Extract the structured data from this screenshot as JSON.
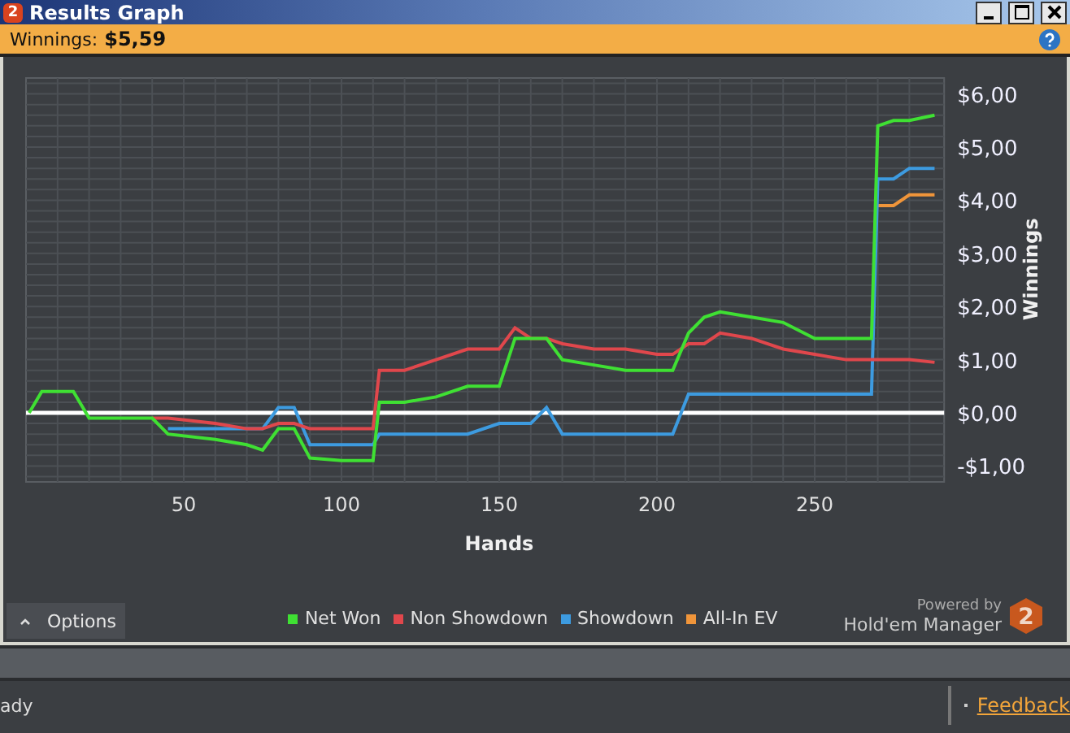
{
  "window": {
    "title": "Results Graph",
    "app_badge": "2"
  },
  "summary": {
    "label": "Winnings:",
    "value": "$5,59"
  },
  "chart": {
    "chart_data": {
      "type": "line",
      "grid": true,
      "xlabel": "Hands",
      "ylabel": "Winnings",
      "x": [
        1,
        5,
        15,
        20,
        40,
        45,
        60,
        70,
        75,
        80,
        85,
        90,
        100,
        110,
        112,
        120,
        130,
        140,
        150,
        155,
        160,
        165,
        170,
        180,
        190,
        200,
        205,
        210,
        215,
        220,
        230,
        240,
        250,
        260,
        268,
        270,
        275,
        280,
        288
      ],
      "xticks": [
        50,
        100,
        150,
        200,
        250
      ],
      "yticks": [
        {
          "value": -1,
          "label": "-$1,00"
        },
        {
          "value": 0,
          "label": "$0,00"
        },
        {
          "value": 1,
          "label": "$1,00"
        },
        {
          "value": 2,
          "label": "$2,00"
        },
        {
          "value": 3,
          "label": "$3,00"
        },
        {
          "value": 4,
          "label": "$4,00"
        },
        {
          "value": 5,
          "label": "$5,00"
        },
        {
          "value": 6,
          "label": "$6,00"
        }
      ],
      "ylim": [
        -1.3,
        6.3
      ],
      "xlim": [
        0,
        290
      ],
      "series": [
        {
          "name": "Net Won",
          "color": "#3fe033",
          "values": [
            0,
            0.4,
            0.4,
            -0.1,
            -0.1,
            -0.4,
            -0.5,
            -0.6,
            -0.7,
            -0.3,
            -0.3,
            -0.85,
            -0.9,
            -0.9,
            0.2,
            0.2,
            0.3,
            0.5,
            0.5,
            1.4,
            1.4,
            1.4,
            1.0,
            0.9,
            0.8,
            0.8,
            0.8,
            1.5,
            1.8,
            1.9,
            1.8,
            1.7,
            1.4,
            1.4,
            1.4,
            5.4,
            5.5,
            5.5,
            5.6
          ]
        },
        {
          "name": "Non Showdown",
          "color": "#e0474c",
          "values": [
            null,
            null,
            null,
            null,
            -0.1,
            -0.1,
            -0.2,
            -0.3,
            -0.3,
            -0.2,
            -0.2,
            -0.3,
            -0.3,
            -0.3,
            0.8,
            0.8,
            1.0,
            1.2,
            1.2,
            1.6,
            1.4,
            1.4,
            1.3,
            1.2,
            1.2,
            1.1,
            1.1,
            1.3,
            1.3,
            1.5,
            1.4,
            1.2,
            1.1,
            1.0,
            1.0,
            1.0,
            1.0,
            1.0,
            0.95
          ]
        },
        {
          "name": "Showdown",
          "color": "#3d9be0",
          "values": [
            null,
            null,
            null,
            null,
            null,
            -0.3,
            -0.3,
            -0.3,
            -0.3,
            0.1,
            0.1,
            -0.6,
            -0.6,
            -0.6,
            -0.4,
            -0.4,
            -0.4,
            -0.4,
            -0.2,
            -0.2,
            -0.2,
            0.1,
            -0.4,
            -0.4,
            -0.4,
            -0.4,
            -0.4,
            0.35,
            0.35,
            0.35,
            0.35,
            0.35,
            0.35,
            0.35,
            0.35,
            4.4,
            4.4,
            4.6,
            4.6
          ]
        },
        {
          "name": "All-In EV",
          "color": "#f0953a",
          "values": [
            null,
            null,
            null,
            null,
            null,
            null,
            null,
            null,
            null,
            null,
            null,
            null,
            null,
            null,
            null,
            null,
            null,
            null,
            null,
            null,
            null,
            null,
            null,
            null,
            null,
            null,
            null,
            null,
            null,
            null,
            null,
            null,
            null,
            null,
            null,
            3.9,
            3.9,
            4.1,
            4.1
          ]
        }
      ]
    },
    "options_button": {
      "label": "Options",
      "expanded": false
    },
    "branding": {
      "caption": "Powered by",
      "product": "Hold'em Manager",
      "badge": "2"
    }
  },
  "status_bar": {
    "status": "ady",
    "link": "Feedback"
  }
}
